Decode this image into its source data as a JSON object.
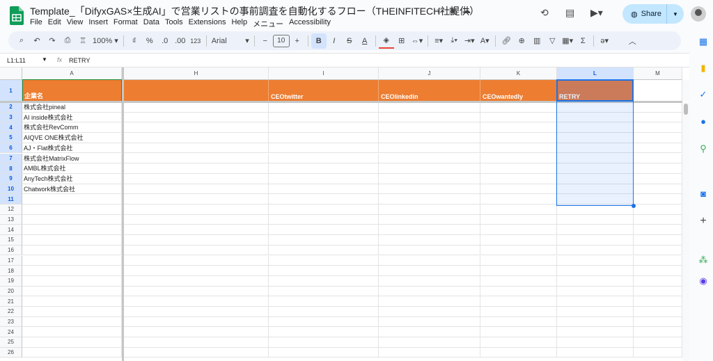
{
  "doc": {
    "title": "Template_「DifyxGAS×生成AI」で営業リストの事前調査を自動化するフロー（THEINFITECH社提供）"
  },
  "menu": [
    "File",
    "Edit",
    "View",
    "Insert",
    "Format",
    "Data",
    "Tools",
    "Extensions",
    "Help",
    "メニュー",
    "Accessibility"
  ],
  "share": {
    "label": "Share"
  },
  "toolbar": {
    "zoom": "100%",
    "font": "Arial",
    "font_size": "10",
    "currency": "₫",
    "percent": "%",
    "dec_less": ".0",
    "dec_more": ".00",
    "format123": "123"
  },
  "formula": {
    "namebox": "L1:L11",
    "fx": "fx",
    "value": "RETRY"
  },
  "columns": [
    "A",
    "H",
    "I",
    "J",
    "K",
    "L",
    "M"
  ],
  "header_row": {
    "A": "企業名",
    "H": "",
    "I": "CEOtwitter",
    "J": "CEOlinkedin",
    "K": "CEOwantedly",
    "L": "RETRY",
    "M": ""
  },
  "companies": [
    "株式会社pineal",
    "AI inside株式会社",
    "株式会社RevComm",
    "AIQVE ONE株式会社",
    "AJ・Flat株式会社",
    "株式会社MatrixFlow",
    "AMBL株式会社",
    "AnyTech株式会社",
    "Chatwork株式会社"
  ],
  "rows": [
    "1",
    "2",
    "3",
    "4",
    "5",
    "6",
    "7",
    "8",
    "9",
    "10",
    "11",
    "12",
    "13",
    "14",
    "15",
    "16",
    "17",
    "18",
    "19",
    "20",
    "21",
    "22",
    "23",
    "24",
    "25",
    "26"
  ],
  "colors": {
    "header_orange": "#ed7d31",
    "selection_blue": "#1a73e8",
    "share_bg": "#c2e7ff"
  }
}
